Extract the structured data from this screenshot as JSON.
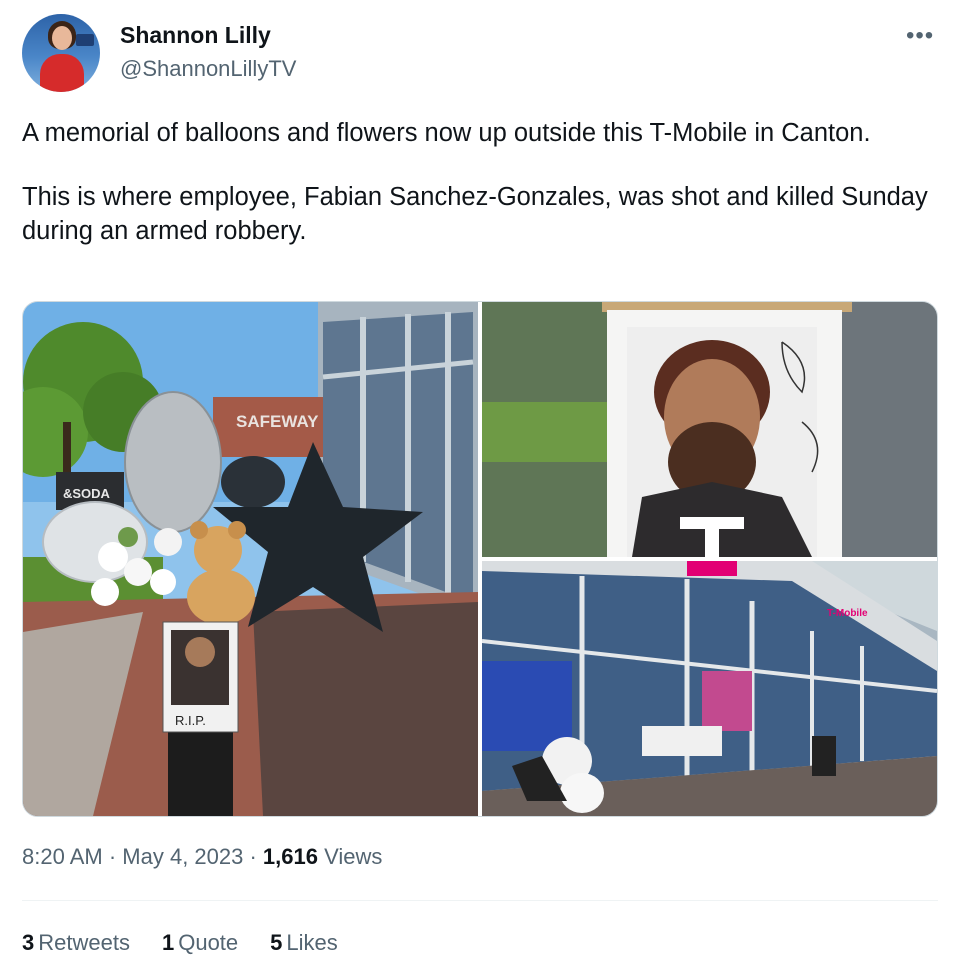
{
  "author": {
    "name": "Shannon Lilly",
    "handle": "@ShannonLillyTV",
    "avatar_icon": "profile-photo"
  },
  "more_icon": "more-horizontal-icon",
  "tweet": {
    "paragraph_1": "A memorial of balloons and flowers now up outside this T-Mobile in Canton.",
    "paragraph_2": "This is where employee, Fabian Sanchez-Gonzales, was shot and killed Sunday during an armed robbery."
  },
  "media": {
    "photo_1_signs": {
      "store_sign": "SAFEWAY",
      "soda_sign": "&SODA",
      "memorial_caption": "R.I.P."
    },
    "photo_3_signs": {
      "store_sign": "T-Mobile"
    }
  },
  "meta": {
    "time": "8:20 AM",
    "separator_1": " · ",
    "date": "May 4, 2023",
    "separator_2": " · ",
    "views_count": "1,616",
    "views_label": " Views"
  },
  "stats": {
    "retweets_count": "3",
    "retweets_label": "Retweets",
    "quotes_count": "1",
    "quotes_label": "Quote",
    "likes_count": "5",
    "likes_label": "Likes"
  },
  "colors": {
    "text_primary": "#0f1419",
    "text_secondary": "#536471",
    "border": "#cfd9de",
    "tmobile_magenta": "#e20074"
  }
}
